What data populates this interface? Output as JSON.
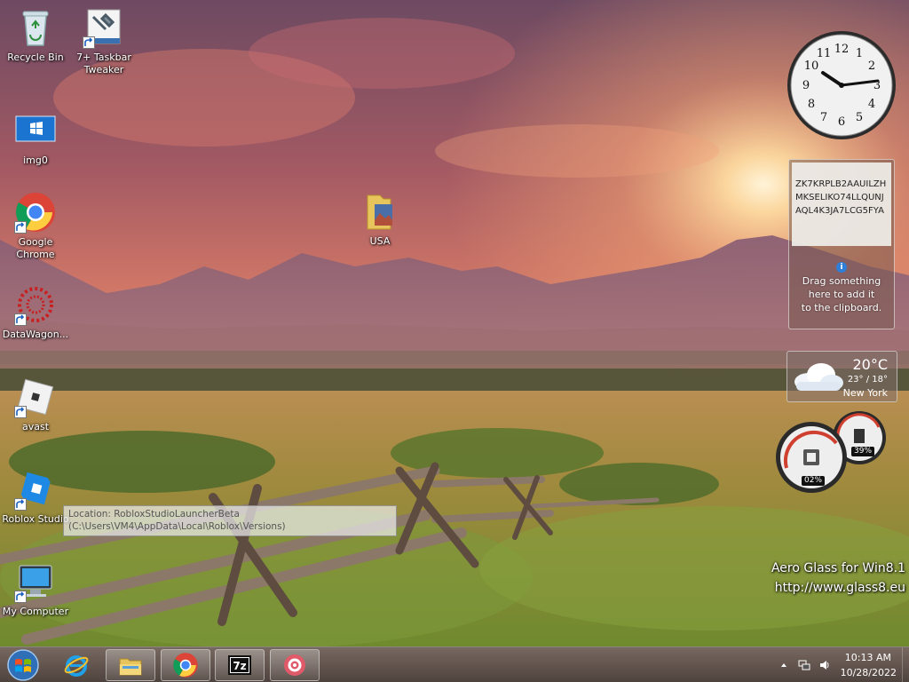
{
  "desktop": {
    "icons": [
      {
        "label": "Recycle Bin",
        "icon": "recycle-bin-icon",
        "shortcut": false
      },
      {
        "label": "7+ Taskbar\nTweaker",
        "icon": "taskbar-tweaker-icon",
        "shortcut": true
      },
      {
        "label": "img0",
        "icon": "image-file-icon",
        "shortcut": false
      },
      {
        "label": "Google\nChrome",
        "icon": "chrome-icon",
        "shortcut": true
      },
      {
        "label": "DataWagon...",
        "icon": "datawagon-icon",
        "shortcut": true
      },
      {
        "label": "avast",
        "icon": "roblox-logo-icon",
        "shortcut": true
      },
      {
        "label": "Roblox Studio",
        "icon": "roblox-studio-icon",
        "shortcut": true
      },
      {
        "label": "My Computer",
        "icon": "computer-icon",
        "shortcut": true
      },
      {
        "label": "USA",
        "icon": "folder-icon",
        "shortcut": false
      }
    ],
    "tooltip": "Location: RobloxStudioLauncherBeta (C:\\Users\\VM4\\AppData\\Local\\Roblox\\Versions)"
  },
  "gadgets": {
    "clock": {
      "time": "10:13"
    },
    "clipboard": {
      "code": "ZK7KRPLB2AAUILZHMKSELIKO74LLQUNJAQL4K3JA7LCG5FYA",
      "hint": "Drag something\nhere to add it\nto the clipboard."
    },
    "weather": {
      "temperature": "20°C",
      "range": "23° / 18°",
      "city": "New York"
    },
    "meter": {
      "cpu": "02%",
      "memory": "39%"
    }
  },
  "watermark": {
    "line1": "Aero Glass for Win8.1",
    "line2": "http://www.glass8.eu"
  },
  "taskbar": {
    "start_icon": "windows-logo-icon",
    "pinned": [
      {
        "name": "internet-explorer",
        "icon": "ie-icon"
      },
      {
        "name": "file-explorer",
        "icon": "file-explorer-icon"
      },
      {
        "name": "google-chrome",
        "icon": "chrome-icon"
      },
      {
        "name": "7zip",
        "icon": "7zip-icon"
      },
      {
        "name": "roblox-studio",
        "icon": "roblox-studio-icon"
      }
    ],
    "tray": {
      "time": "10:13 AM",
      "date": "10/28/2022"
    }
  },
  "colors": {
    "sun": "#ffd9a0",
    "sky_top": "#7b4a60",
    "grass": "#8a9a3c"
  }
}
